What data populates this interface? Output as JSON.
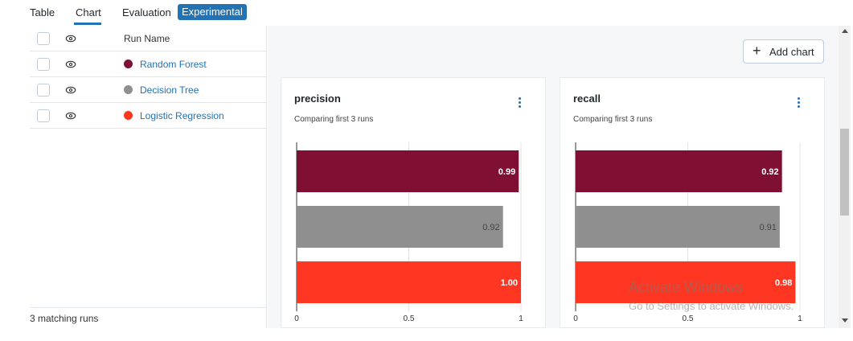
{
  "tabs": {
    "table": "Table",
    "chart": "Chart",
    "evaluation": "Evaluation",
    "experimental": "Experimental"
  },
  "runs_table": {
    "header": "Run Name",
    "rows": [
      {
        "name": "Random Forest",
        "color": "#7f1034"
      },
      {
        "name": "Decision Tree",
        "color": "#8f8f8f"
      },
      {
        "name": "Logistic Regression",
        "color": "#ff3621"
      }
    ],
    "footer": "3 matching runs"
  },
  "toolbar": {
    "add_chart_label": "Add chart",
    "add_icon": "plus-icon"
  },
  "charts": [
    {
      "title": "precision",
      "subtitle": "Comparing first 3 runs",
      "menu_icon": "kebab-icon"
    },
    {
      "title": "recall",
      "subtitle": "Comparing first 3 runs",
      "menu_icon": "kebab-icon"
    }
  ],
  "chart_data": [
    {
      "type": "bar",
      "orientation": "horizontal",
      "categories": [
        "Random Forest",
        "Decision Tree",
        "Logistic Regression"
      ],
      "values": [
        0.99,
        0.92,
        1.0
      ],
      "labels": [
        "0.99",
        "0.92",
        "1.00"
      ],
      "colors": [
        "#7f1034",
        "#8f8f8f",
        "#ff3621"
      ],
      "xlim": [
        0,
        1
      ],
      "xticks": [
        "0",
        "0.5",
        "1"
      ],
      "title": "precision"
    },
    {
      "type": "bar",
      "orientation": "horizontal",
      "categories": [
        "Random Forest",
        "Decision Tree",
        "Logistic Regression"
      ],
      "values": [
        0.92,
        0.91,
        0.98
      ],
      "labels": [
        "0.92",
        "0.91",
        "0.98"
      ],
      "colors": [
        "#7f1034",
        "#8f8f8f",
        "#ff3621"
      ],
      "xlim": [
        0,
        1
      ],
      "xticks": [
        "0",
        "0.5",
        "1"
      ],
      "title": "recall"
    }
  ],
  "watermark": {
    "line1": "Activate Windows",
    "line2": "Go to Settings to activate Windows."
  }
}
